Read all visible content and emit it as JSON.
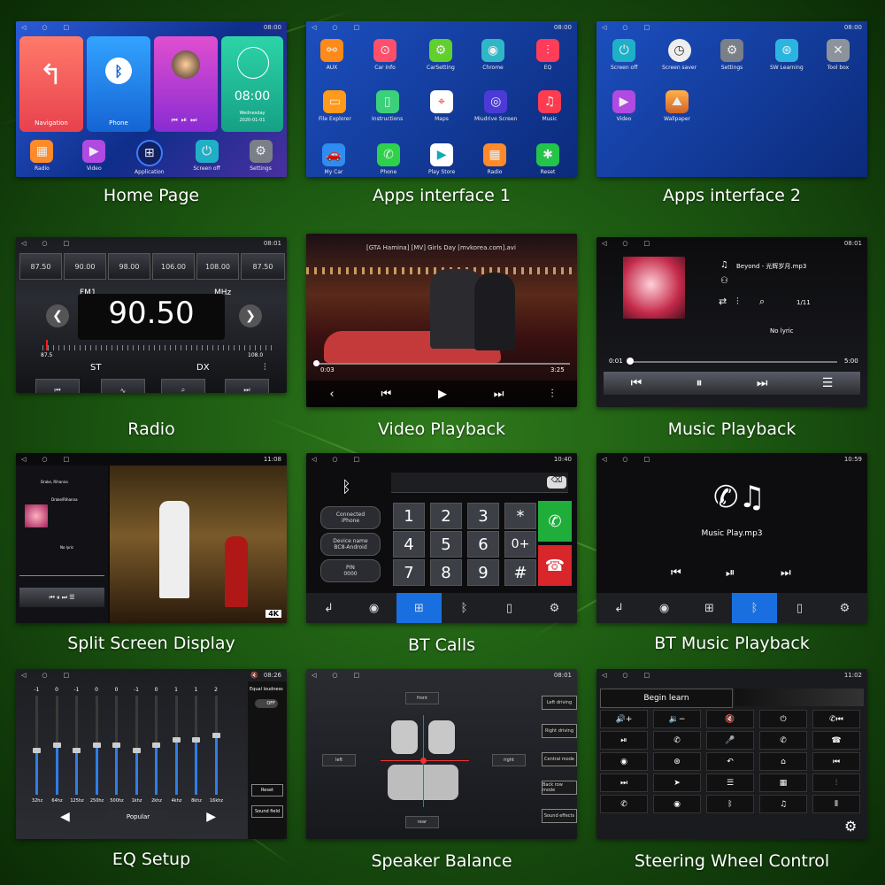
{
  "captions": {
    "home": "Home Page",
    "apps1": "Apps interface 1",
    "apps2": "Apps interface 2",
    "radio": "Radio",
    "video": "Video Playback",
    "music": "Music Playback",
    "split": "Split Screen Display",
    "btcalls": "BT Calls",
    "btmusic": "BT Music Playback",
    "eq": "EQ Setup",
    "speaker": "Speaker Balance",
    "steering": "Steering Wheel Control"
  },
  "home": {
    "time": "08:00",
    "tiles": {
      "navigation": "Navigation",
      "phone": "Phone"
    },
    "clock_time": "08:00",
    "clock_day": "Wednesday",
    "clock_date": "2020-01-01",
    "dock": [
      "Radio",
      "Video",
      "Application",
      "Screen off",
      "Settings"
    ]
  },
  "apps1": {
    "time": "08:00",
    "apps": [
      "AUX",
      "Car Info",
      "CarSetting",
      "Chrome",
      "EQ",
      "File Explorer",
      "Instructions",
      "Maps",
      "Miudrive Screen",
      "Music",
      "My Car",
      "Phone",
      "Play Store",
      "Radio",
      "Reset"
    ]
  },
  "apps2": {
    "time": "08:00",
    "apps": [
      "Screen off",
      "Screen saver",
      "Settings",
      "SW Learning",
      "Tool box",
      "Video",
      "Wallpaper"
    ]
  },
  "radio": {
    "time": "08:01",
    "presets": [
      "87.50",
      "90.00",
      "98.00",
      "106.00",
      "108.00",
      "87.50"
    ],
    "band": "FM1",
    "unit": "MHz",
    "frequency": "90.50",
    "range_min": "87.5",
    "range_max": "108.0",
    "st": "ST",
    "dx": "DX"
  },
  "video": {
    "file": "[GTA Hamina] [MV] Girls Day [mvkorea.com].avi",
    "elapsed": "0:03",
    "total": "3:25"
  },
  "music": {
    "time": "08:01",
    "song": "Beyond - 光辉岁月.mp3",
    "track": "1/11",
    "lyric": "No lyric",
    "elapsed": "0:01",
    "total": "5:00"
  },
  "split": {
    "time": "11:08",
    "line1": "Drake, Rihanna",
    "line2": "Drake/Rihanna",
    "line3": "No lyric",
    "badge": "4K"
  },
  "btcalls": {
    "time": "10:40",
    "status": "Connected",
    "device": "iPhone",
    "name_label": "Device name",
    "name_value": "BC8-Android",
    "pin_label": "PIN",
    "pin_value": "0000",
    "keys": [
      "1",
      "2",
      "3",
      "*",
      "4",
      "5",
      "6",
      "0+",
      "7",
      "8",
      "9",
      "#"
    ]
  },
  "btmusic": {
    "time": "10:59",
    "file": "Music Play.mp3"
  },
  "eq": {
    "time": "08:26",
    "values": [
      "-1",
      "0",
      "-1",
      "0",
      "0",
      "-1",
      "0",
      "1",
      "1",
      "2"
    ],
    "levels": [
      0.45,
      0.5,
      0.45,
      0.5,
      0.5,
      0.45,
      0.5,
      0.55,
      0.55,
      0.6
    ],
    "bands": [
      "32hz",
      "64hz",
      "125hz",
      "250hz",
      "500hz",
      "1khz",
      "2khz",
      "4khz",
      "8khz",
      "16khz"
    ],
    "loudness": "Equal loudness",
    "toggle": "OFF",
    "reset": "Reset",
    "sound_field": "Sound field",
    "preset": "Popular"
  },
  "speaker": {
    "time": "08:01",
    "front": "front",
    "rear": "rear",
    "left": "left",
    "right": "right",
    "modes": [
      "Left driving",
      "Right driving",
      "Central mode",
      "Back row mode",
      "Sound effects"
    ]
  },
  "steering": {
    "time": "11:02",
    "begin": "Begin learn"
  },
  "colors": {
    "accent": "#1a6fe0",
    "answer": "#1fae3a",
    "hangup": "#d8262b"
  }
}
